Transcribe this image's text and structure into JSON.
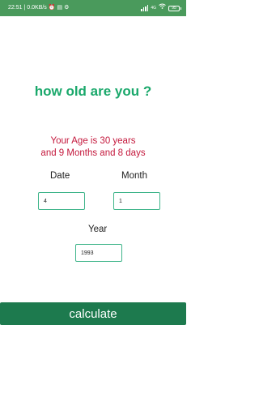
{
  "status_bar": {
    "time": "22:51",
    "network_speed": "| 0.0KB/s",
    "battery_level": "95",
    "icons": [
      "alarm-icon",
      "storage-icon",
      "settings-gear-icon",
      "signal-icon",
      "4g-icon",
      "wifi-icon",
      "battery-icon"
    ],
    "color": "#4a9a5c"
  },
  "app": {
    "title": "how old are you ?",
    "title_color": "#1aa86b",
    "result_line1": "Your Age is 30 years",
    "result_line2": "and 9 Months and 8 days",
    "result_color": "#c4183c"
  },
  "form": {
    "date_label": "Date",
    "date_value": "4",
    "month_label": "Month",
    "month_value": "1",
    "year_label": "Year",
    "year_value": "1993",
    "border_color": "#3fb58a"
  },
  "actions": {
    "calculate_label": "calculate",
    "button_color": "#1d7a4e"
  }
}
